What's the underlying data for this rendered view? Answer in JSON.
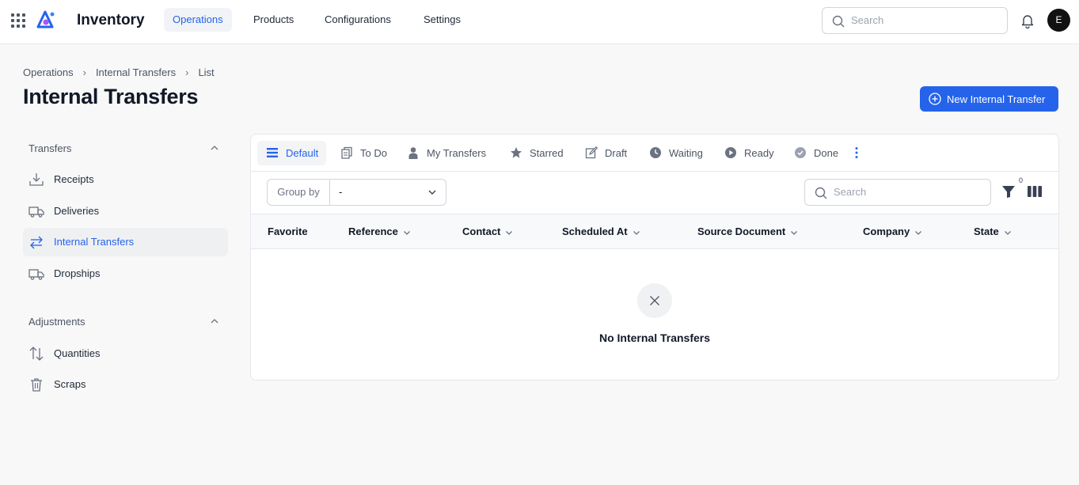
{
  "app": {
    "title": "Inventory",
    "avatar_initial": "E"
  },
  "nav": [
    {
      "label": "Operations",
      "active": true
    },
    {
      "label": "Products"
    },
    {
      "label": "Configurations"
    },
    {
      "label": "Settings"
    }
  ],
  "search": {
    "placeholder": "Search"
  },
  "breadcrumb": [
    "Operations",
    "Internal Transfers",
    "List"
  ],
  "page": {
    "title": "Internal Transfers",
    "new_button": "New Internal Transfer"
  },
  "sidebar": {
    "sections": [
      {
        "title": "Transfers",
        "items": [
          {
            "label": "Receipts",
            "icon": "receipt-download-icon"
          },
          {
            "label": "Deliveries",
            "icon": "truck-icon"
          },
          {
            "label": "Internal Transfers",
            "icon": "arrows-exchange-icon",
            "active": true
          },
          {
            "label": "Dropships",
            "icon": "truck-icon"
          }
        ]
      },
      {
        "title": "Adjustments",
        "items": [
          {
            "label": "Quantities",
            "icon": "arrows-up-down-icon"
          },
          {
            "label": "Scraps",
            "icon": "trash-icon"
          }
        ]
      }
    ]
  },
  "tabs": [
    {
      "label": "Default",
      "icon": "list-icon",
      "active": true
    },
    {
      "label": "To Do",
      "icon": "clipboard-icon"
    },
    {
      "label": "My Transfers",
      "icon": "user-icon"
    },
    {
      "label": "Starred",
      "icon": "star-icon"
    },
    {
      "label": "Draft",
      "icon": "pencil-icon"
    },
    {
      "label": "Waiting",
      "icon": "clock-icon"
    },
    {
      "label": "Ready",
      "icon": "play-icon"
    },
    {
      "label": "Done",
      "icon": "check-circle-icon"
    }
  ],
  "toolbar": {
    "group_by_label": "Group by",
    "group_by_value": "-",
    "search_placeholder": "Search",
    "filter_count": "0"
  },
  "table": {
    "columns": [
      "Favorite",
      "Reference",
      "Contact",
      "Scheduled At",
      "Source Document",
      "Company",
      "State"
    ],
    "empty_message": "No Internal Transfers"
  },
  "colors": {
    "accent": "#2563eb",
    "background": "#f8f8f8"
  }
}
